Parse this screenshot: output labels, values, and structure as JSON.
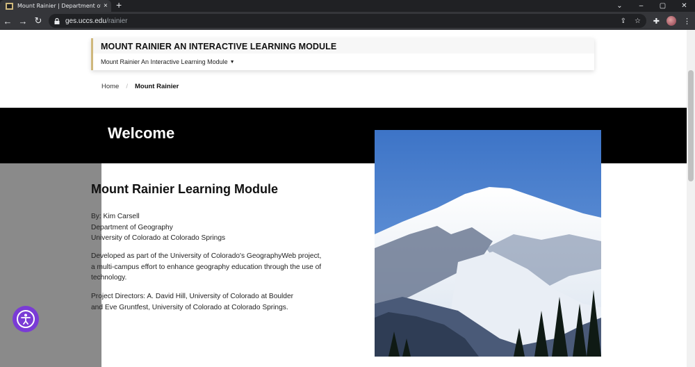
{
  "browser": {
    "tab_title": "Mount Rainier | Department of G",
    "tab_close": "×",
    "new_tab": "+",
    "url_host": "ges.uccs.edu",
    "url_path": "/rainier",
    "win_minimize": "⌄",
    "win_min": "–",
    "win_max": "▢",
    "win_close": "✕",
    "back": "←",
    "forward": "→",
    "reload": "↻",
    "share": "⇪",
    "star": "☆",
    "extensions": "✚",
    "menu": "⋮"
  },
  "header": {
    "site_title": "MOUNT RAINIER AN INTERACTIVE LEARNING MODULE",
    "nav_label": "Mount Rainier An Interactive Learning Module",
    "caret": "▼"
  },
  "breadcrumb": {
    "home": "Home",
    "sep": "/",
    "current": "Mount Rainier"
  },
  "hero": {
    "title": "Welcome"
  },
  "main": {
    "heading": "Mount Rainier Learning Module",
    "author_lines": [
      "By: Kim Carsell",
      "Department of Geography",
      "University of Colorado at Colorado Springs"
    ],
    "developed_lines": [
      "Developed as part of the University of Colorado's GeographyWeb project,",
      "a multi-campus effort to enhance geography education through the use of",
      "technology."
    ],
    "directors_lines": [
      "Project Directors: A. David Hill, University of Colorado at Boulder",
      "and Eve Gruntfest, University of Colorado at Colorado Springs."
    ]
  },
  "icons": {
    "favicon": "tab-favicon",
    "lock": "lock-icon",
    "accessibility": "accessibility-icon"
  },
  "colors": {
    "hero_band": "#000000",
    "gold_accent": "#cfb87c",
    "a11y_purple": "#7a3bd6"
  }
}
